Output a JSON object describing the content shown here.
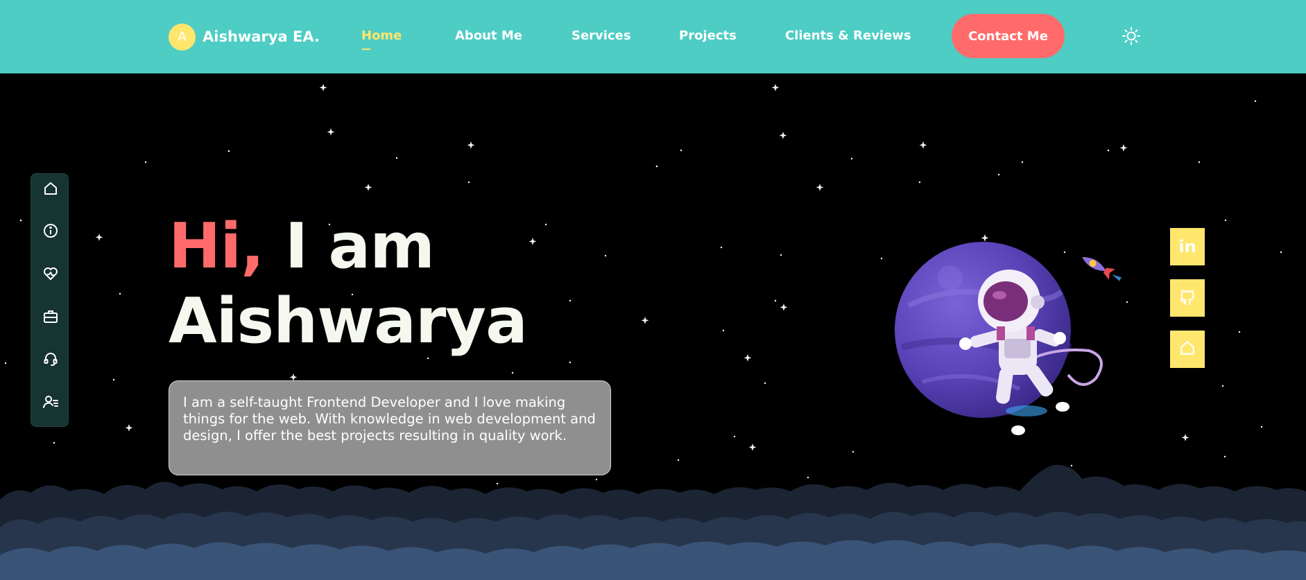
{
  "header": {
    "brand_initial": "A",
    "brand_name": "Aishwarya EA.",
    "nav": [
      {
        "label": "Home",
        "active": true
      },
      {
        "label": "About Me",
        "active": false
      },
      {
        "label": "Services",
        "active": false
      },
      {
        "label": "Projects",
        "active": false
      },
      {
        "label": "Clients & Reviews",
        "active": false
      }
    ],
    "contact_label": "Contact Me",
    "theme_icon": "sun-icon"
  },
  "side_nav": {
    "items": [
      {
        "icon": "home-icon"
      },
      {
        "icon": "info-icon"
      },
      {
        "icon": "service-heart-icon"
      },
      {
        "icon": "briefcase-icon"
      },
      {
        "icon": "headset-icon"
      },
      {
        "icon": "user-list-icon"
      }
    ]
  },
  "hero": {
    "greeting": "Hi,",
    "greeting_rest": " I am",
    "name": "Aishwarya",
    "intro": "I am a self-taught Frontend Developer and I love making things for the web. With knowledge in web development and design, I offer the best projects resulting in quality work."
  },
  "social": {
    "linkedin_label": "in",
    "items": [
      {
        "icon": "linkedin-icon"
      },
      {
        "icon": "github-icon"
      },
      {
        "icon": "home-icon"
      }
    ]
  },
  "colors": {
    "header_bg": "#4ecdc4",
    "accent_yellow": "#ffe66d",
    "accent_red": "#ff6b6b",
    "sidebar_bg": "#163431"
  }
}
